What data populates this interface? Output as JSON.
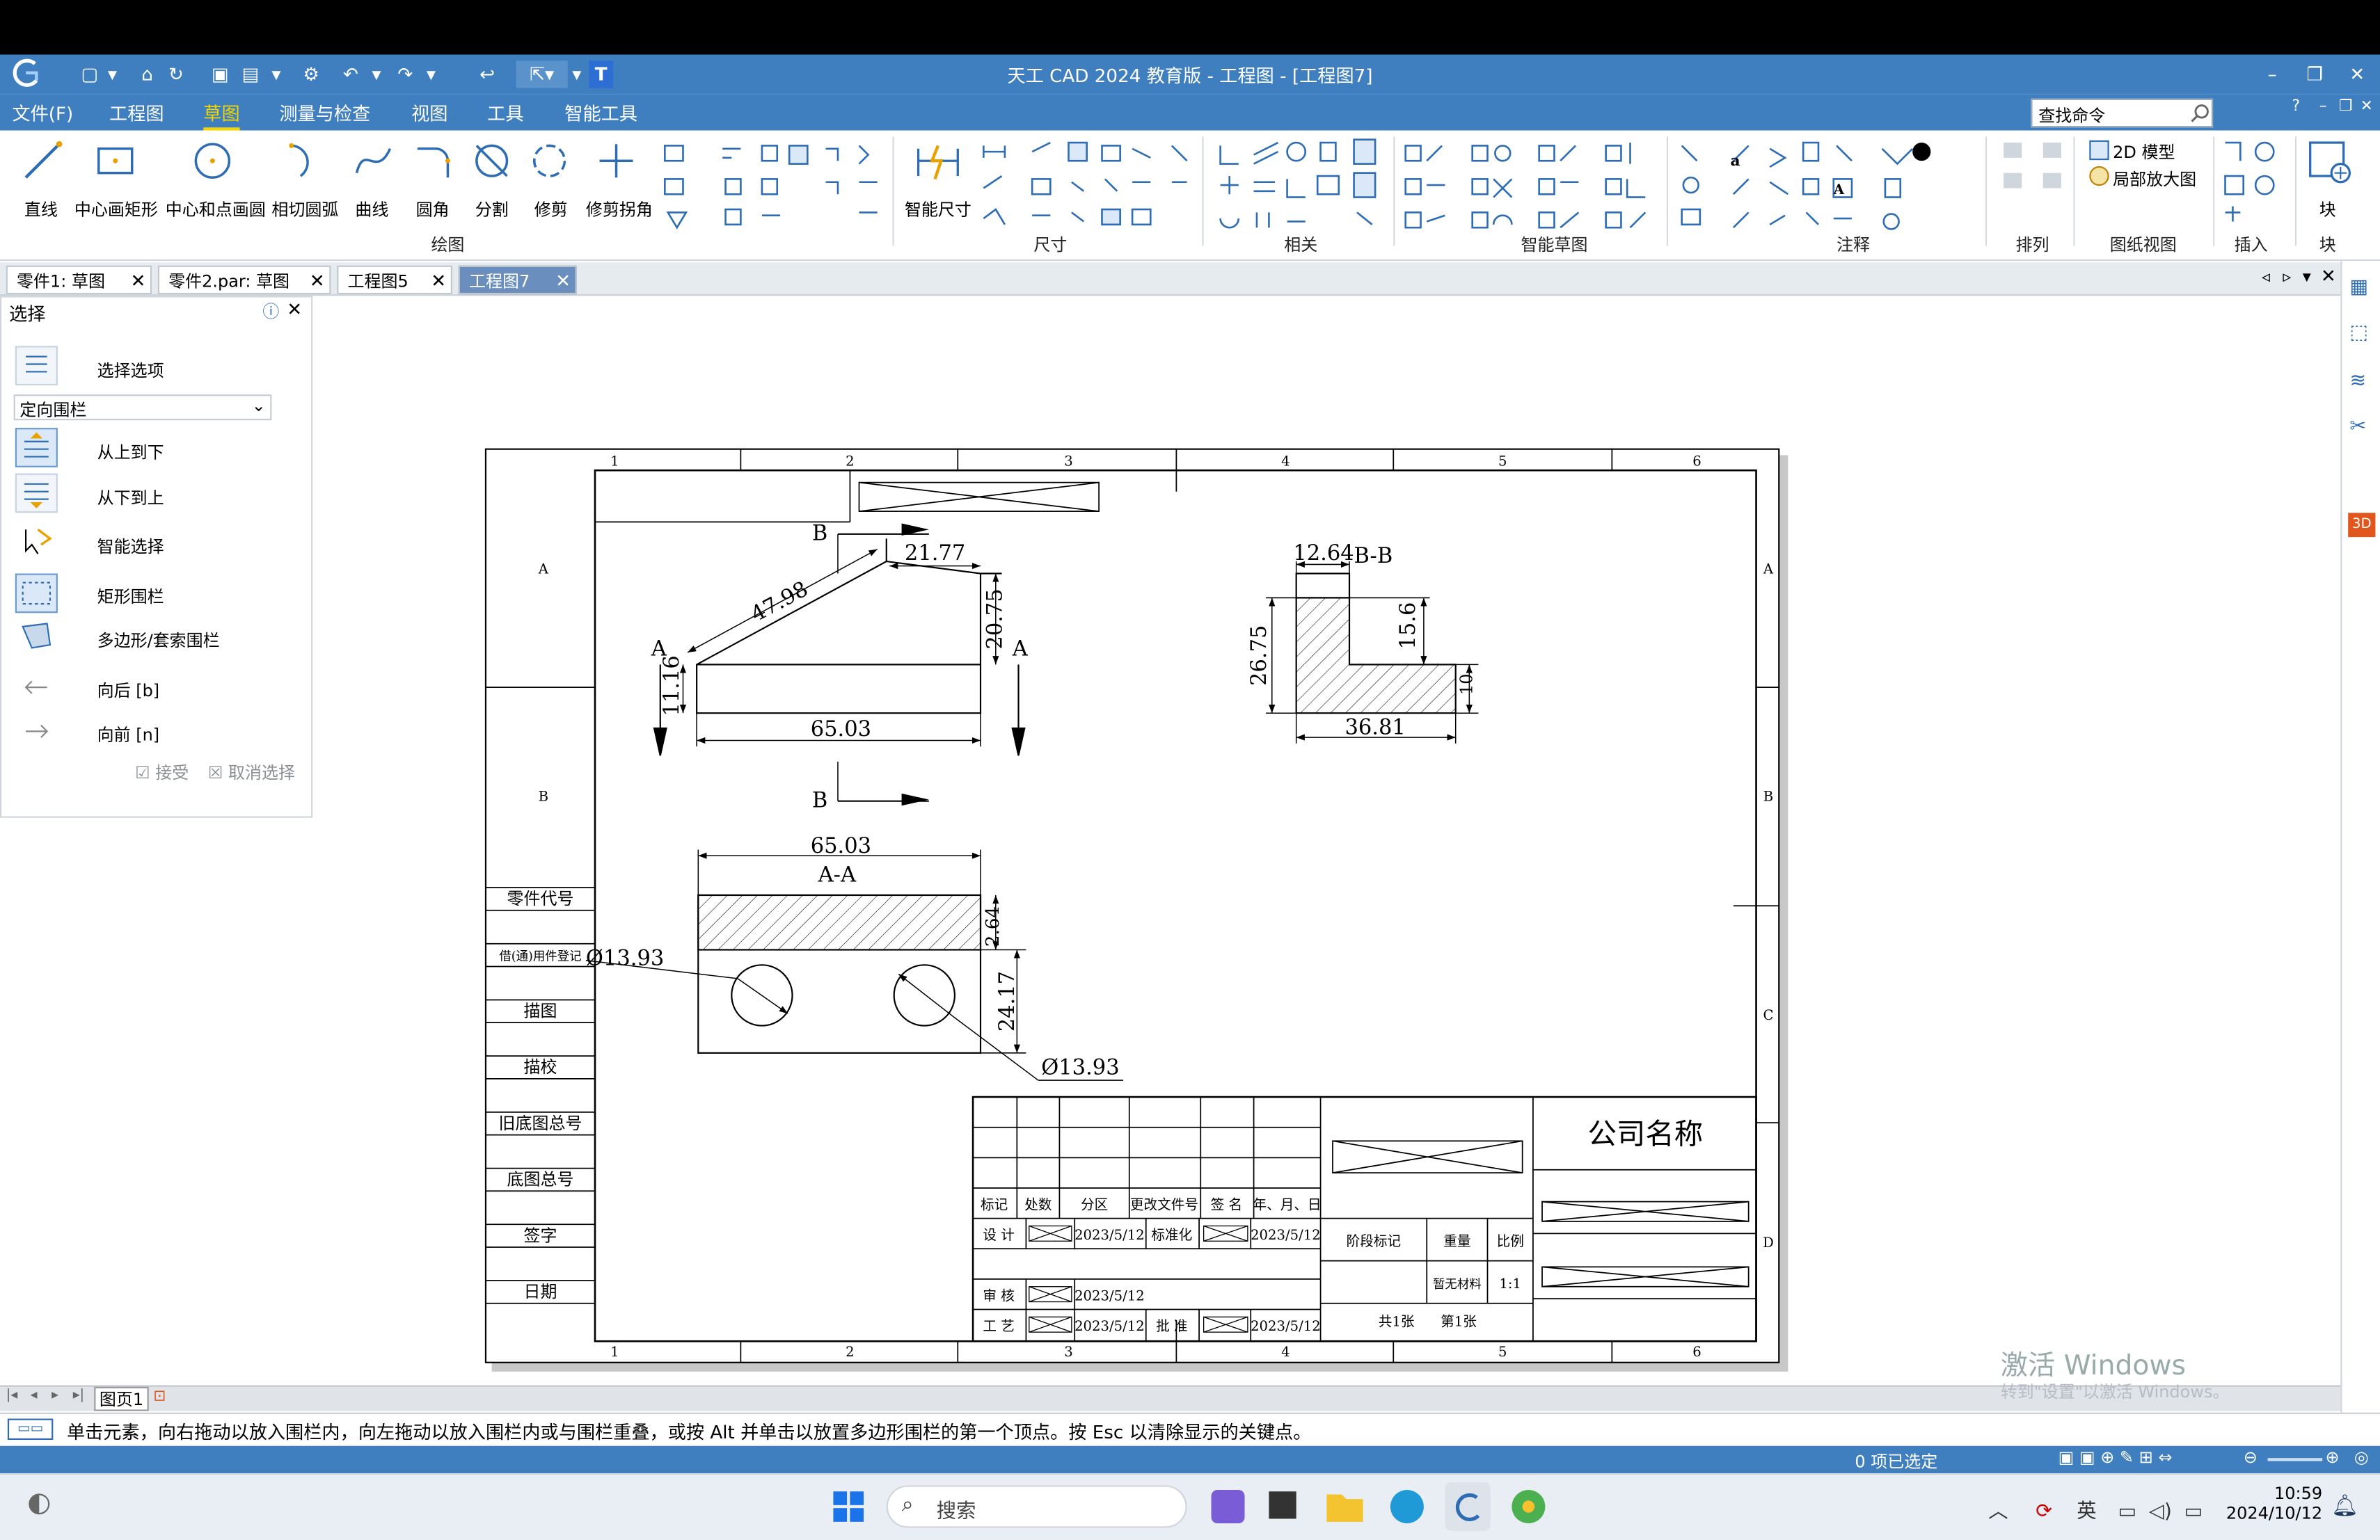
{
  "window": {
    "title": "天工 CAD 2024 教育版 - 工程图 - [工程图7]"
  },
  "menu": {
    "items": [
      "文件(F)",
      "工程图",
      "草图",
      "测量与检查",
      "视图",
      "工具",
      "智能工具"
    ],
    "active": "草图"
  },
  "find_command": {
    "placeholder": "查找命令"
  },
  "ribbon": {
    "draw": {
      "buttons": [
        "直线",
        "中心画矩形",
        "中心和点画圆",
        "相切圆弧",
        "曲线",
        "圆角",
        "分割",
        "修剪",
        "修剪拐角"
      ],
      "group": "绘图"
    },
    "smart_dim": "智能尺寸",
    "groups": {
      "dim": "尺寸",
      "rel": "相关",
      "smart_sketch": "智能草图",
      "anno": "注释",
      "arrange": "排列",
      "sheet": "图纸视图",
      "insert": "插入",
      "block": "块"
    },
    "sheet_buttons": [
      "2D 模型",
      "局部放大图"
    ],
    "block_button": "块"
  },
  "doc_tabs": [
    "零件1: 草图",
    "零件2.par: 草图",
    "工程图5",
    "工程图7"
  ],
  "active_doc_tab": "工程图7",
  "left_panel": {
    "title": "选择",
    "options_label": "选择选项",
    "dropdown_value": "定向围栏",
    "items": [
      "从上到下",
      "从下到上",
      "智能选择",
      "矩形围栏",
      "多边形/套索围栏",
      "向后 [b]",
      "向前 [n]"
    ],
    "accept": "接受",
    "cancel": "取消选择"
  },
  "drawing": {
    "col_labels": [
      "1",
      "2",
      "3",
      "4",
      "5",
      "6"
    ],
    "row_labels": [
      "A",
      "B",
      "C",
      "D"
    ],
    "dims": {
      "d1": "47.98",
      "d2": "21.77",
      "d3": "20.75",
      "d4": "11.16",
      "d5": "65.03",
      "d6": "65.03",
      "d7": "12.64",
      "d8": "26.75",
      "d9": "15.6",
      "d10": "36.81",
      "d11": "2.64",
      "d12": "24.17",
      "d13": "Ø13.93",
      "d14": "Ø13.93",
      "d15": "10"
    },
    "section_labels": {
      "B": "B",
      "A": "A",
      "BB": "B-B",
      "AA": "A-A"
    },
    "left_table": [
      "零件代号",
      "借(通)用件登记",
      "描图",
      "描校",
      "旧底图总号",
      "底图总号",
      "签字",
      "日期"
    ],
    "title_block": {
      "company": "公司名称",
      "headers": [
        "标记",
        "处数",
        "分区",
        "更改文件号",
        "签 名",
        "年、月、日"
      ],
      "design": "设 计",
      "date1": "2023/5/12",
      "standard": "标准化",
      "date2": "2023/5/12",
      "stage": "阶段标记",
      "weight": "重量",
      "scale_label": "比例",
      "scale_value": "1:1",
      "weight_val": "暂无材料",
      "review": "审 核",
      "date3": "2023/5/12",
      "process": "工 艺",
      "date4": "2023/5/12",
      "approve": "批 准",
      "date5": "2023/5/12",
      "sheets": "共1张",
      "sheet_no": "第1张"
    }
  },
  "page_tab": "图页1",
  "status_message": "单击元素，向右拖动以放入围栏内，向左拖动以放入围栏内或与围栏重叠，或按 Alt 并单击以放置多边形围栏的第一个顶点。按 Esc 以清除显示的关键点。",
  "status_selected": "0 项已选定",
  "watermark": {
    "line1": "激活 Windows",
    "line2": "转到\"设置\"以激活 Windows。"
  },
  "taskbar": {
    "search": "搜索",
    "ime": "英",
    "time": "10:59",
    "date": "2024/10/12"
  },
  "colors": {
    "accent": "#3f7fc0",
    "active_menu": "#f2d600"
  }
}
